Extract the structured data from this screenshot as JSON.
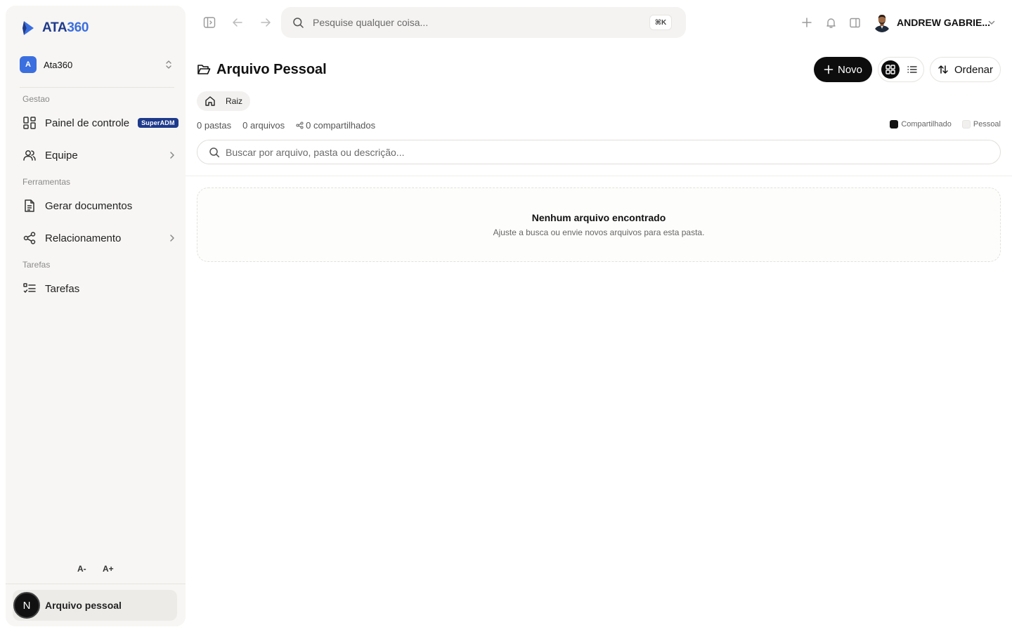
{
  "brand": {
    "part1": "ATA",
    "part2": "360"
  },
  "org": {
    "initial": "A",
    "name": "Ata360"
  },
  "sidebar": {
    "sections": [
      "Gestao",
      "Ferramentas",
      "Tarefas"
    ],
    "items": [
      {
        "label": "Painel de controle",
        "badge": "SuperADM"
      },
      {
        "label": "Equipe"
      },
      {
        "label": "Gerar documentos"
      },
      {
        "label": "Relacionamento"
      },
      {
        "label": "Tarefas"
      }
    ],
    "font_decrease": "A-",
    "font_increase": "A+",
    "account": {
      "initial": "N",
      "label": "Arquivo pessoal"
    }
  },
  "topbar": {
    "search_placeholder": "Pesquise qualquer coisa...",
    "shortcut": "⌘K",
    "user_name": "ANDREW GABRIE..."
  },
  "page": {
    "title": "Arquivo Pessoal",
    "new_button": "Novo",
    "sort_button": "Ordenar",
    "breadcrumb": "Raiz",
    "stats": {
      "folders": "0 pastas",
      "files": "0 arquivos",
      "shared": "0 compartilhados"
    },
    "legend": {
      "shared": "Compartilhado",
      "personal": "Pessoal"
    },
    "filter_placeholder": "Buscar por arquivo, pasta ou descrição...",
    "empty": {
      "title": "Nenhum arquivo encontrado",
      "subtitle": "Ajuste a busca ou envie novos arquivos para esta pasta."
    }
  },
  "colors": {
    "brand_dark": "#1f3a8a",
    "brand_light": "#3b6fe0",
    "badge": "#1e3a8a",
    "primary_button": "#0d0d0d"
  }
}
